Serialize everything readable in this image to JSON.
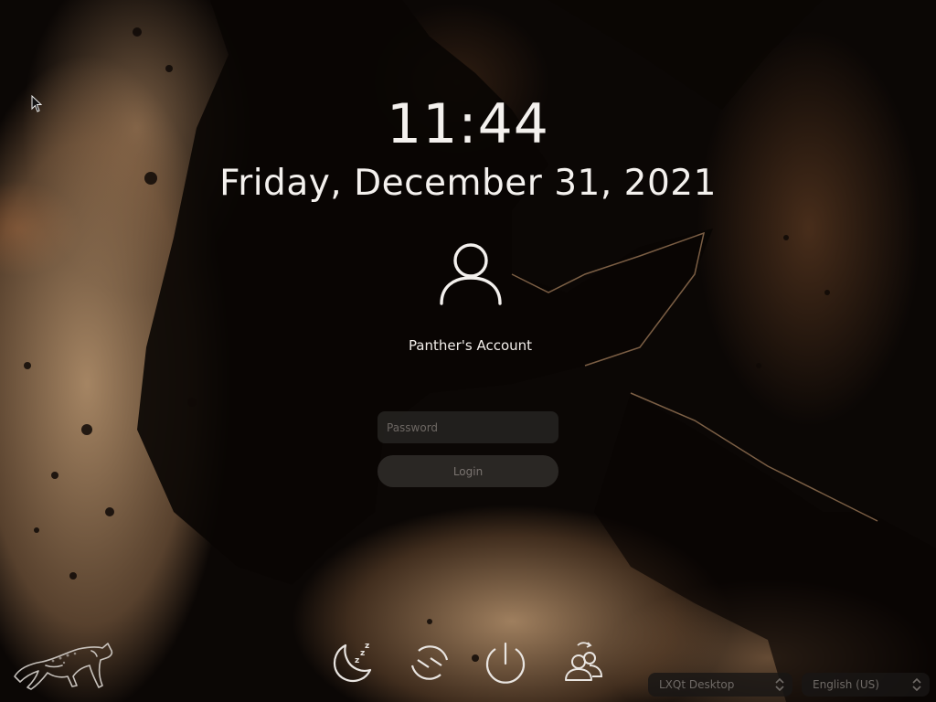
{
  "clock": {
    "time": "11:44",
    "date": "Friday, December 31, 2021"
  },
  "user": {
    "account_name": "Panther's Account",
    "avatar_icon": "user-icon"
  },
  "login_form": {
    "password_placeholder": "Password",
    "password_value": "",
    "login_label": "Login"
  },
  "power_controls": [
    {
      "name": "suspend",
      "icon": "moon-sleep-icon"
    },
    {
      "name": "restart",
      "icon": "restart-icon"
    },
    {
      "name": "shutdown",
      "icon": "power-icon"
    },
    {
      "name": "switch-user",
      "icon": "switch-user-icon"
    }
  ],
  "selectors": {
    "session": "LXQt Desktop",
    "language": "English (US)"
  },
  "branding": {
    "logo_icon": "panther-logo"
  },
  "colors": {
    "text": "#f4f1ee",
    "field_background": "#282624",
    "button_background": "#302d2a",
    "muted_text": "#6f6a66"
  }
}
